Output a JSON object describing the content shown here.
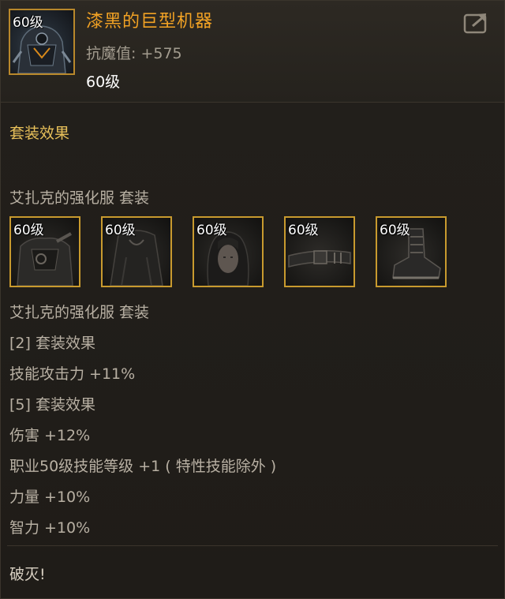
{
  "item": {
    "level_tag": "60级",
    "name": "漆黑的巨型机器",
    "stat": "抗魔值: +575",
    "level": "60级"
  },
  "icons": {
    "share": "share-out-icon"
  },
  "section_title": "套装效果",
  "set_name_top": "艾扎克的强化服  套装",
  "set_pieces": [
    {
      "level_tag": "60级",
      "icon": "chest-armor-icon"
    },
    {
      "level_tag": "60级",
      "icon": "cloak-icon"
    },
    {
      "level_tag": "60级",
      "icon": "head-hair-icon"
    },
    {
      "level_tag": "60级",
      "icon": "belt-icon"
    },
    {
      "level_tag": "60级",
      "icon": "boots-icon"
    }
  ],
  "set_name_bottom": "艾扎克的强化服  套装",
  "effects": [
    "[2] 套装效果",
    "技能攻击力 +11%",
    "[5] 套装效果",
    "伤害 +12%",
    "职业50级技能等级 +1 ( 特性技能除外 )",
    "力量 +10%",
    "智力 +10%"
  ],
  "footer": "破灭!",
  "colors": {
    "item_name": "#f2a224",
    "section_title": "#e8c05a",
    "slot_border": "#c89a2e"
  }
}
